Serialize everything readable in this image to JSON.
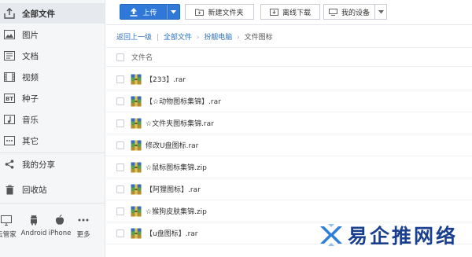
{
  "sidebar": {
    "items": [
      {
        "label": "全部文件",
        "icon": "upload-box-icon",
        "active": true
      },
      {
        "label": "图片",
        "icon": "picture-icon"
      },
      {
        "label": "文档",
        "icon": "document-icon"
      },
      {
        "label": "视频",
        "icon": "film-icon"
      },
      {
        "label": "种子",
        "icon": "bt-icon"
      },
      {
        "label": "音乐",
        "icon": "music-note-icon"
      },
      {
        "label": "其它",
        "icon": "more-dots-icon"
      }
    ],
    "share_label": "我的分享",
    "recycle_label": "回收站",
    "devices": [
      "云管家",
      "Android",
      "iPhone",
      "更多"
    ]
  },
  "toolbar": {
    "upload_label": "上传",
    "new_folder_label": "新建文件夹",
    "offline_label": "离线下载",
    "my_device_label": "我的设备"
  },
  "breadcrumb": {
    "back": "返回上一级",
    "sep": "|",
    "items": [
      "全部文件",
      "扮靓电脑",
      "文件图标"
    ],
    "arrow": "›"
  },
  "list": {
    "column_name": "文件名",
    "files": [
      "【233】.rar",
      "【☆动物图标集锦】.rar",
      "☆文件夹图标集锦.rar",
      "修改U盘图标.rar",
      "☆鼠标图标集锦.zip",
      "【阿狸图标】.rar",
      "☆猴狗皮肤集锦.zip",
      "【u盘图标】.rar"
    ]
  },
  "watermark": {
    "text": "易企推网络"
  },
  "colors": {
    "accent": "#2f78d8",
    "link": "#2f6fb6",
    "sidebar_bg": "#f5f6f8",
    "watermark": "#1a3f8f"
  }
}
